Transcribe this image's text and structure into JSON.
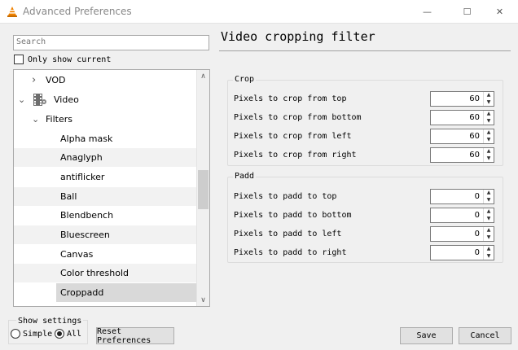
{
  "window": {
    "title": "Advanced Preferences",
    "minimize": "—",
    "maximize": "☐",
    "close": "✕"
  },
  "search": {
    "placeholder": "Search",
    "value": ""
  },
  "only_show_current": {
    "label": "Only show current",
    "checked": false
  },
  "tree": [
    {
      "label": "VOD",
      "expander": "›"
    },
    {
      "label": "Video",
      "expander": "⌄"
    },
    {
      "label": "Filters",
      "expander": "⌄"
    },
    {
      "label": "Alpha mask"
    },
    {
      "label": "Anaglyph"
    },
    {
      "label": "antiflicker"
    },
    {
      "label": "Ball"
    },
    {
      "label": "Blendbench"
    },
    {
      "label": "Bluescreen"
    },
    {
      "label": "Canvas"
    },
    {
      "label": "Color threshold"
    },
    {
      "label": "Croppadd",
      "selected": true
    }
  ],
  "scroll": {
    "up": "∧",
    "down": "∨"
  },
  "panel": {
    "title": "Video cropping filter",
    "crop": {
      "label": "Crop",
      "fields": [
        {
          "label": "Pixels to crop from top",
          "value": "60"
        },
        {
          "label": "Pixels to crop from bottom",
          "value": "60"
        },
        {
          "label": "Pixels to crop from left",
          "value": "60"
        },
        {
          "label": "Pixels to crop from right",
          "value": "60"
        }
      ]
    },
    "padd": {
      "label": "Padd",
      "fields": [
        {
          "label": "Pixels to padd to top",
          "value": "0"
        },
        {
          "label": "Pixels to padd to bottom",
          "value": "0"
        },
        {
          "label": "Pixels to padd to left",
          "value": "0"
        },
        {
          "label": "Pixels to padd to right",
          "value": "0"
        }
      ]
    },
    "spin_up": "▲",
    "spin_down": "▼"
  },
  "show_settings": {
    "label": "Show settings",
    "simple": "Simple",
    "all": "All",
    "selected": "All"
  },
  "buttons": {
    "reset": "Reset Preferences",
    "save": "Save",
    "cancel": "Cancel"
  },
  "colors": {
    "accent": "#f08200",
    "selected_row": "#d9d9d9"
  }
}
